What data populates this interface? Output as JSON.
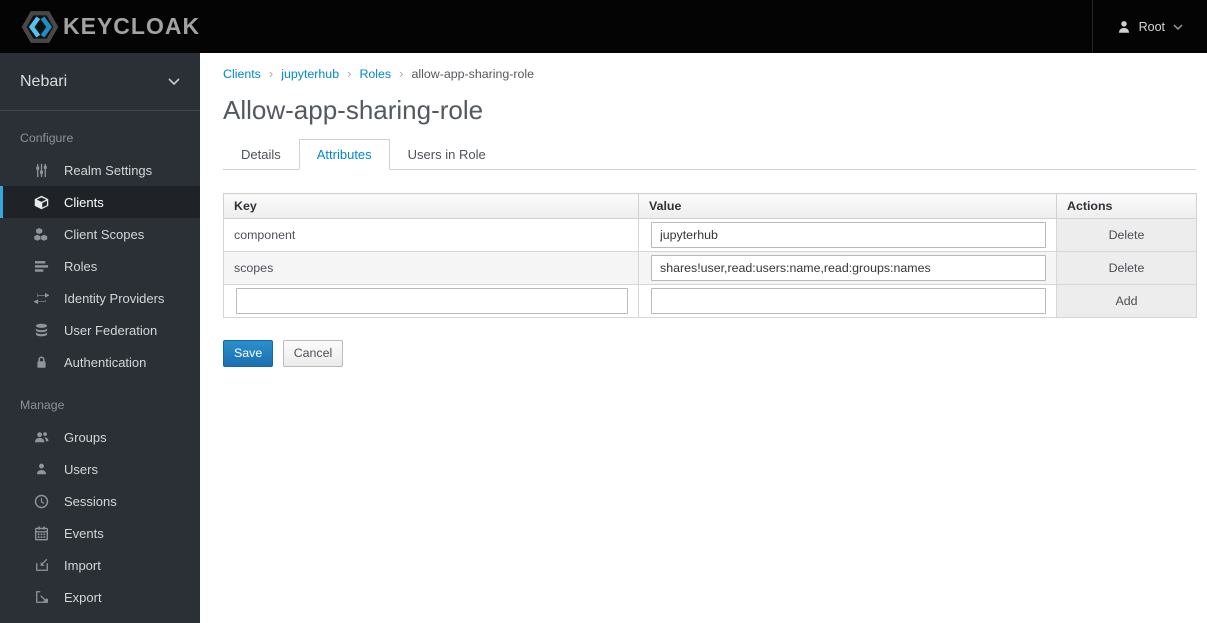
{
  "topbar": {
    "brand": "KEYCLOAK",
    "user_name": "Root"
  },
  "sidebar": {
    "realm_name": "Nebari",
    "sections": [
      {
        "label": "Configure",
        "items": [
          {
            "label": "Realm Settings",
            "icon": "sliders-icon",
            "active": false
          },
          {
            "label": "Clients",
            "icon": "cube-icon",
            "active": true
          },
          {
            "label": "Client Scopes",
            "icon": "cubes-icon",
            "active": false
          },
          {
            "label": "Roles",
            "icon": "list-icon",
            "active": false
          },
          {
            "label": "Identity Providers",
            "icon": "exchange-icon",
            "active": false
          },
          {
            "label": "User Federation",
            "icon": "database-icon",
            "active": false
          },
          {
            "label": "Authentication",
            "icon": "lock-icon",
            "active": false
          }
        ]
      },
      {
        "label": "Manage",
        "items": [
          {
            "label": "Groups",
            "icon": "groups-icon",
            "active": false
          },
          {
            "label": "Users",
            "icon": "user-icon",
            "active": false
          },
          {
            "label": "Sessions",
            "icon": "clock-icon",
            "active": false
          },
          {
            "label": "Events",
            "icon": "calendar-icon",
            "active": false
          },
          {
            "label": "Import",
            "icon": "import-icon",
            "active": false
          },
          {
            "label": "Export",
            "icon": "export-icon",
            "active": false
          }
        ]
      }
    ]
  },
  "breadcrumb": {
    "separator": "›",
    "items": [
      "Clients",
      "jupyterhub",
      "Roles",
      "allow-app-sharing-role"
    ]
  },
  "page": {
    "title": "Allow-app-sharing-role"
  },
  "tabs": [
    {
      "label": "Details",
      "active": false
    },
    {
      "label": "Attributes",
      "active": true
    },
    {
      "label": "Users in Role",
      "active": false
    }
  ],
  "attributes_table": {
    "headers": {
      "key": "Key",
      "value": "Value",
      "actions": "Actions"
    },
    "rows": [
      {
        "key": "component",
        "value": "jupyterhub",
        "action": "Delete"
      },
      {
        "key": "scopes",
        "value": "shares!user,read:users:name,read:groups:names",
        "action": "Delete"
      },
      {
        "key": "",
        "value": "",
        "action": "Add"
      }
    ]
  },
  "form_actions": {
    "save": "Save",
    "cancel": "Cancel"
  },
  "colors": {
    "accent": "#0088ce",
    "topbar_bg": "#040404",
    "sidebar_bg": "#2b3036",
    "sidebar_active_border": "#39a5dc",
    "primary_button": "#1a6fb1",
    "striped_row": "#f5f5f5"
  }
}
